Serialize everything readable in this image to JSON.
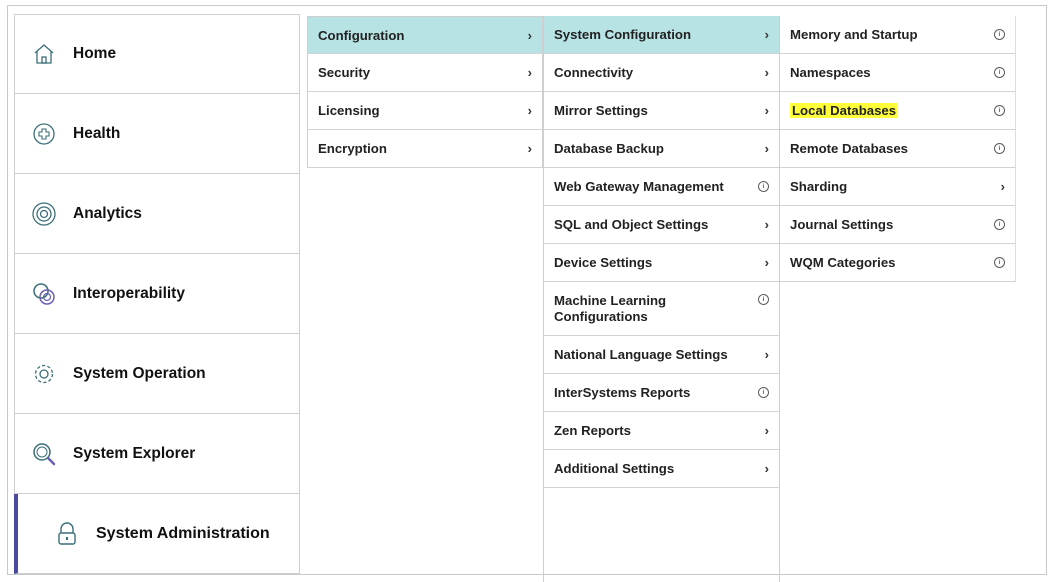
{
  "nav": {
    "items": [
      {
        "label": "Home",
        "icon": "home-icon"
      },
      {
        "label": "Health",
        "icon": "health-plus-icon"
      },
      {
        "label": "Analytics",
        "icon": "target-icon"
      },
      {
        "label": "Interoperability",
        "icon": "linked-rings-icon"
      },
      {
        "label": "System Operation",
        "icon": "gear-icon"
      },
      {
        "label": "System Explorer",
        "icon": "magnifier-icon"
      },
      {
        "label": "System Administration",
        "icon": "lock-icon",
        "active": true
      }
    ],
    "active_color": "#4a4aa3"
  },
  "menu1": {
    "items": [
      {
        "label": "Configuration",
        "type": "chevron",
        "selected": true
      },
      {
        "label": "Security",
        "type": "chevron"
      },
      {
        "label": "Licensing",
        "type": "chevron"
      },
      {
        "label": "Encryption",
        "type": "chevron"
      }
    ],
    "selected_color": "#b7e3e5"
  },
  "menu2": {
    "items": [
      {
        "label": "System Configuration",
        "type": "chevron",
        "selected": true
      },
      {
        "label": "Connectivity",
        "type": "chevron"
      },
      {
        "label": "Mirror Settings",
        "type": "chevron"
      },
      {
        "label": "Database Backup",
        "type": "chevron"
      },
      {
        "label": "Web Gateway Management",
        "type": "info"
      },
      {
        "label": "SQL and Object Settings",
        "type": "chevron"
      },
      {
        "label": "Device Settings",
        "type": "chevron"
      },
      {
        "label": "Machine Learning Configurations",
        "type": "info",
        "tall": true
      },
      {
        "label": "National Language Settings",
        "type": "chevron"
      },
      {
        "label": "InterSystems Reports",
        "type": "info"
      },
      {
        "label": "Zen Reports",
        "type": "chevron"
      },
      {
        "label": "Additional Settings",
        "type": "chevron"
      }
    ]
  },
  "menu3": {
    "items": [
      {
        "label": "Memory and Startup",
        "type": "info"
      },
      {
        "label": "Namespaces",
        "type": "info"
      },
      {
        "label": "Local Databases",
        "type": "info",
        "highlighted": true
      },
      {
        "label": "Remote Databases",
        "type": "info"
      },
      {
        "label": "Sharding",
        "type": "chevron"
      },
      {
        "label": "Journal Settings",
        "type": "info"
      },
      {
        "label": "WQM Categories",
        "type": "info"
      }
    ],
    "highlight_color": "#ffff3a"
  },
  "glyphs": {
    "chevron": "›",
    "info": "i"
  }
}
